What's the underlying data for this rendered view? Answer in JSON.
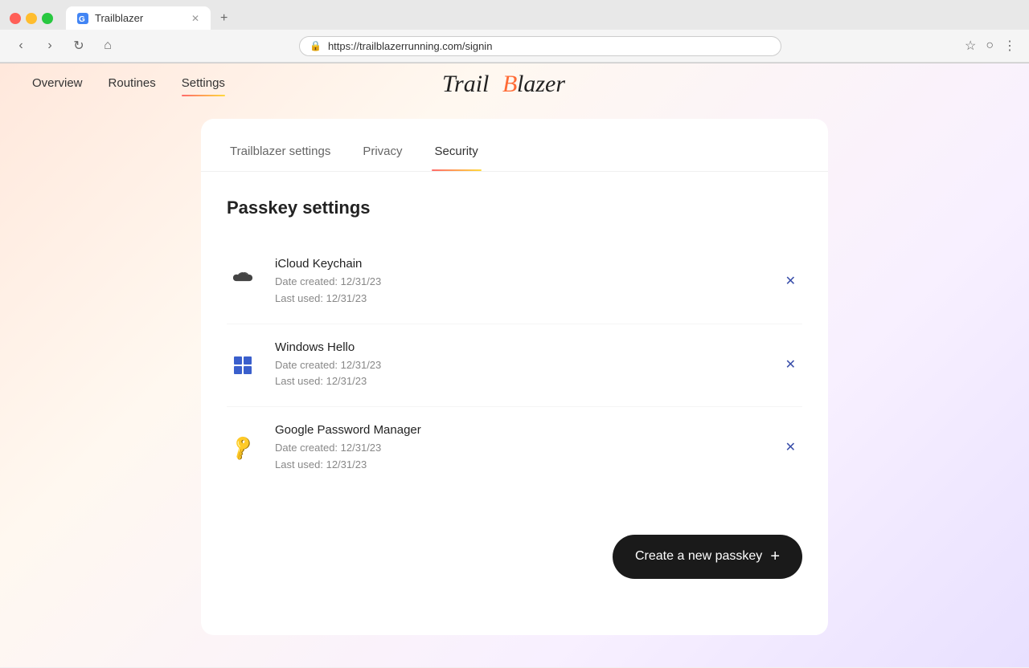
{
  "browser": {
    "tab_title": "Trailblazer",
    "url": "https://trailblazerrunning.com/signin",
    "new_tab_label": "+"
  },
  "nav": {
    "links": [
      {
        "id": "overview",
        "label": "Overview",
        "active": false
      },
      {
        "id": "routines",
        "label": "Routines",
        "active": false
      },
      {
        "id": "settings",
        "label": "Settings",
        "active": true
      }
    ],
    "logo": "TrailBlazer"
  },
  "settings": {
    "tabs": [
      {
        "id": "trailblazer-settings",
        "label": "Trailblazer settings",
        "active": false
      },
      {
        "id": "privacy",
        "label": "Privacy",
        "active": false
      },
      {
        "id": "security",
        "label": "Security",
        "active": true
      }
    ],
    "section_title": "Passkey settings",
    "passkeys": [
      {
        "id": "icloud-keychain",
        "name": "iCloud Keychain",
        "date_created": "Date created: 12/31/23",
        "last_used": "Last used: 12/31/23",
        "icon_type": "apple"
      },
      {
        "id": "windows-hello",
        "name": "Windows Hello",
        "date_created": "Date created: 12/31/23",
        "last_used": "Last used: 12/31/23",
        "icon_type": "windows"
      },
      {
        "id": "google-password-manager",
        "name": "Google Password Manager",
        "date_created": "Date created: 12/31/23",
        "last_used": "Last used: 12/31/23",
        "icon_type": "key"
      }
    ],
    "create_button_label": "Create a new passkey",
    "create_button_plus": "+"
  }
}
